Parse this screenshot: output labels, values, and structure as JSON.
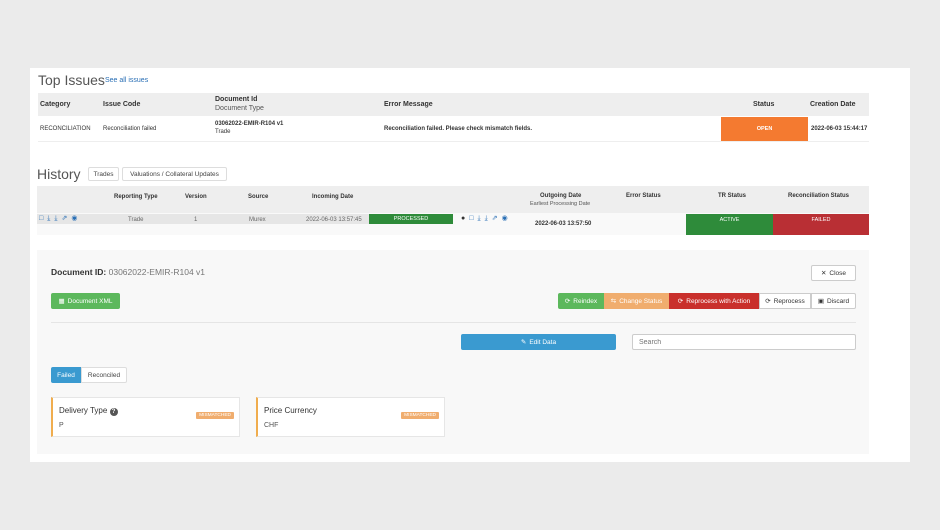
{
  "top_issues": {
    "title": "Top Issues",
    "see_all": "See all issues",
    "columns": {
      "category": "Category",
      "issue_code": "Issue Code",
      "document_id": "Document Id",
      "document_type": "Document Type",
      "error_message": "Error Message",
      "status": "Status",
      "creation_date": "Creation Date"
    },
    "row": {
      "category": "RECONCILIATION",
      "issue_code": "Reconciliation failed",
      "document_id": "03062022-EMIR-R104 v1",
      "document_type": "Trade",
      "error_message": "Reconciliation failed. Please check mismatch fields.",
      "status": "OPEN",
      "creation_date": "2022-06-03 15:44:17"
    }
  },
  "history": {
    "title": "History",
    "tabs": [
      "Trades",
      "Valuations / Collateral Updates"
    ],
    "columns": {
      "reporting_type": "Reporting Type",
      "version": "Version",
      "source": "Source",
      "incoming_date": "Incoming Date",
      "outgoing_date": "Outgoing Date",
      "earliest_processing_date": "Earliest Processing Date",
      "error_status": "Error Status",
      "tr_status": "TR Status",
      "reconciliation_status": "Reconciliation Status"
    },
    "row": {
      "reporting_type": "Trade",
      "version": "1",
      "source": "Murex",
      "incoming_date": "2022-06-03 13:57:45",
      "processing_status": "PROCESSED",
      "outgoing_date": "2022-06-03 13:57:50",
      "tr_status": "ACTIVE",
      "reconciliation_status": "FAILED"
    }
  },
  "document": {
    "label": "Document ID:",
    "id": "03062022-EMIR-R104 v1",
    "close": "Close",
    "document_xml": "Document XML",
    "actions": {
      "reindex": "Reindex",
      "change_status": "Change Status",
      "reprocess_with_action": "Reprocess with Action",
      "reprocess": "Reprocess",
      "discard": "Discard"
    },
    "edit_data": "Edit Data",
    "search_placeholder": "Search",
    "filter_tabs": [
      "Failed",
      "Reconciled"
    ],
    "fields": [
      {
        "label": "Delivery Type",
        "badge": "MISMATCHED",
        "value": "P"
      },
      {
        "label": "Price Currency",
        "badge": "MISMATCHED",
        "value": "CHF"
      }
    ]
  },
  "colors": {
    "open": "#f47a30",
    "processed": "#2e8b3a",
    "active": "#2e8b3a",
    "failed": "#b92f34",
    "primary": "#3a9ad0",
    "success": "#5cb85c",
    "warning": "#f0ad6e",
    "danger": "#c9302c"
  }
}
